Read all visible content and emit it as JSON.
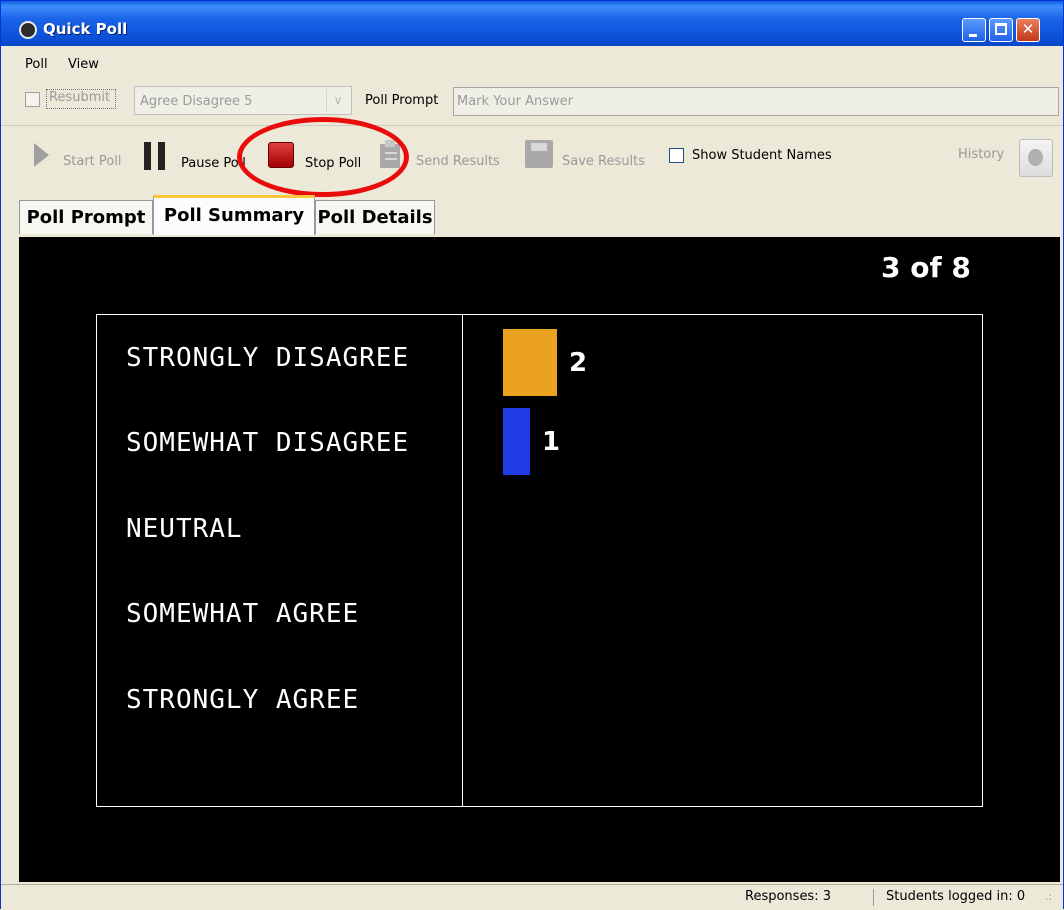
{
  "window": {
    "title": "Quick Poll"
  },
  "menu": {
    "items": [
      "Poll",
      "View"
    ]
  },
  "controls": {
    "resubmit_label": "Resubmit",
    "answer_type": "Agree Disagree 5",
    "prompt_label": "Poll Prompt",
    "prompt_placeholder": "Mark Your Answer"
  },
  "toolbar": {
    "start": "Start Poll",
    "pause": "Pause Poll",
    "stop": "Stop Poll",
    "send": "Send Results",
    "save": "Save Results",
    "show_names": "Show Student Names",
    "history": "History"
  },
  "tabs": [
    "Poll Prompt",
    "Poll Summary",
    "Poll Details"
  ],
  "summary": {
    "counter": "3 of 8"
  },
  "chart_data": {
    "type": "bar",
    "orientation": "horizontal",
    "categories": [
      "STRONGLY DISAGREE",
      "SOMEWHAT DISAGREE",
      "NEUTRAL",
      "SOMEWHAT AGREE",
      "STRONGLY AGREE"
    ],
    "values": [
      2,
      1,
      0,
      0,
      0
    ],
    "value_labels": [
      "2",
      "1",
      "",
      "",
      ""
    ],
    "colors": [
      "#eba31f",
      "#1f3ce6",
      "#000000",
      "#000000",
      "#000000"
    ]
  },
  "status": {
    "responses": "Responses: 3",
    "logged_in": "Students logged in: 0"
  }
}
